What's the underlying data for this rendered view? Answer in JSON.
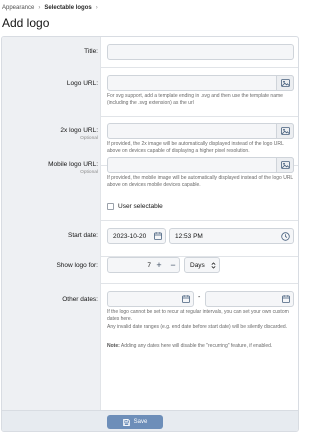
{
  "breadcrumb": {
    "items": [
      "Appearance",
      "Selectable logos"
    ],
    "separator": "›"
  },
  "page": {
    "title": "Add logo"
  },
  "form": {
    "title": {
      "label": "Title:",
      "value": ""
    },
    "logo_url": {
      "label": "Logo URL:",
      "value": "",
      "help": "For svg support, add a template ending in .svg and then use the template name (including the .svg extension) as the url"
    },
    "logo_2x": {
      "label": "2x logo URL:",
      "sublabel": "Optional",
      "value": "",
      "help": "If provided, the 2x image will be automatically displayed instead of the logo URL above on devices capable of displaying a higher pixel resolution."
    },
    "mobile_logo": {
      "label": "Mobile logo URL:",
      "sublabel": "Optional",
      "value": "",
      "help": "If provided, the mobile image will be automatically displayed instead of the logo URL above on devices mobile devices capable."
    },
    "user_selectable": {
      "label": "User selectable",
      "checked": false
    },
    "start_date": {
      "label": "Start date:",
      "date": "2023-10-20",
      "time": "12:53 PM"
    },
    "show_for": {
      "label": "Show logo for:",
      "value": "7",
      "plus": "+",
      "minus": "−",
      "unit": "Days"
    },
    "other_dates": {
      "label": "Other dates:",
      "separator": "-",
      "help": "If the logo cannot be set to recur at regular intervals, you can set your own custom dates here.",
      "help2": "Any invalid date ranges (e.g. end date before start date) will be silently discarded.",
      "note_bold": "Note:",
      "note": " Adding any dates here will disable the \"recurring\" feature, if enabled."
    }
  },
  "actions": {
    "save_label": "Save"
  },
  "colors": {
    "accent": "#6d8eb9",
    "icon": "#47607e"
  },
  "icons": {
    "image": "image-icon",
    "calendar": "calendar-icon",
    "clock": "clock-icon",
    "save": "save-icon",
    "chevron": "chevron-updown-icon"
  }
}
